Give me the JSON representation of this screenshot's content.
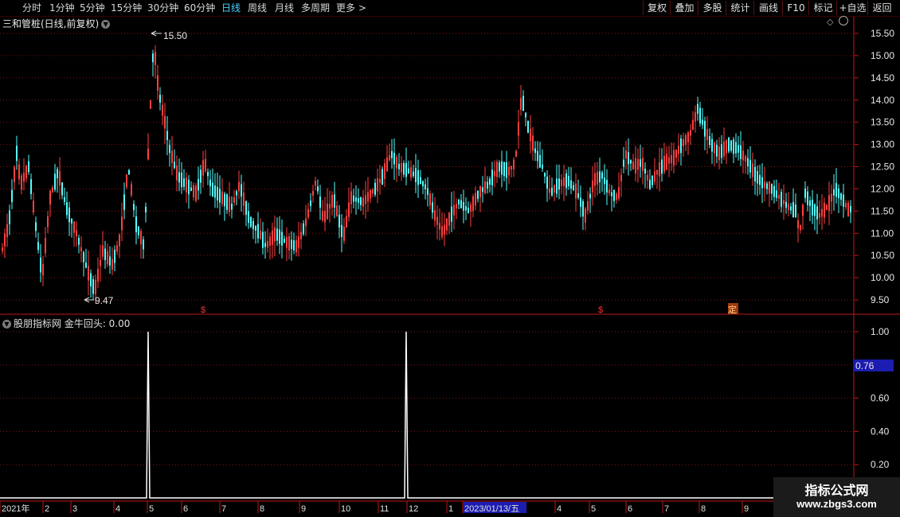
{
  "toolbar": {
    "periods": [
      "分时",
      "1分钟",
      "5分钟",
      "15分钟",
      "30分钟",
      "60分钟",
      "日线",
      "周线",
      "月线",
      "多周期",
      "更多"
    ],
    "active_period": "日线",
    "more_arrow": ">",
    "actions": [
      "复权",
      "叠加",
      "多股",
      "统计",
      "画线",
      "F10",
      "标记",
      "+自选",
      "返回"
    ]
  },
  "chart_header": {
    "title": "三和管桩(日线,前复权)"
  },
  "indicator_header": {
    "title": "股朋指标网 金牛回头: 0.00"
  },
  "price_axis": [
    "15.50",
    "15.00",
    "14.50",
    "14.00",
    "13.50",
    "13.00",
    "12.50",
    "12.00",
    "11.50",
    "11.00",
    "10.50",
    "10.00",
    "9.50"
  ],
  "indicator_axis": [
    "1.00",
    "0.80",
    "0.60",
    "0.40",
    "0.20"
  ],
  "indicator_cursor_value": "0.76",
  "annotations": {
    "high": "15.50",
    "low": "9.47"
  },
  "markers": [
    "$",
    "$",
    "定"
  ],
  "date_axis": [
    "2021年",
    "2",
    "3",
    "4",
    "5",
    "6",
    "7",
    "8",
    "9",
    "10",
    "11",
    "12",
    "1",
    "2023/01/13/五",
    "4",
    "5",
    "6",
    "7",
    "8",
    "9"
  ],
  "watermark": {
    "line1": "指标公式网",
    "line2": "www.zbgs3.com"
  },
  "colors": {
    "up": "#ff4040",
    "down": "#54ffff",
    "grid": "#8a1010",
    "axis_line": "#c01818",
    "cursor_box": "#1c1cb0"
  },
  "chart_data": [
    {
      "type": "candlestick",
      "title": "三和管桩(日线,前复权)",
      "ylim": [
        9.3,
        15.75
      ],
      "y_ticks": [
        15.5,
        15.0,
        14.5,
        14.0,
        13.5,
        13.0,
        12.5,
        12.0,
        11.5,
        11.0,
        10.5,
        10.0,
        9.5
      ],
      "annotated_high": 15.5,
      "annotated_low": 9.47,
      "close_path": [
        [
          0,
          10.5
        ],
        [
          10,
          11.2
        ],
        [
          20,
          12.8
        ],
        [
          25,
          12.1
        ],
        [
          35,
          12.5
        ],
        [
          45,
          11.0
        ],
        [
          52,
          10.0
        ],
        [
          62,
          11.8
        ],
        [
          72,
          12.4
        ],
        [
          82,
          11.6
        ],
        [
          95,
          11.0
        ],
        [
          110,
          10.1
        ],
        [
          118,
          9.7
        ],
        [
          128,
          10.6
        ],
        [
          140,
          10.3
        ],
        [
          150,
          10.9
        ],
        [
          160,
          12.5
        ],
        [
          170,
          11.2
        ],
        [
          180,
          10.7
        ],
        [
          186,
          13.2
        ],
        [
          192,
          15.3
        ],
        [
          198,
          14.2
        ],
        [
          205,
          13.6
        ],
        [
          212,
          12.9
        ],
        [
          222,
          12.3
        ],
        [
          232,
          12.1
        ],
        [
          245,
          11.9
        ],
        [
          256,
          12.6
        ],
        [
          265,
          12.0
        ],
        [
          278,
          11.8
        ],
        [
          290,
          11.6
        ],
        [
          300,
          12.1
        ],
        [
          312,
          11.3
        ],
        [
          325,
          11.0
        ],
        [
          333,
          10.7
        ],
        [
          345,
          11.0
        ],
        [
          358,
          10.8
        ],
        [
          372,
          10.7
        ],
        [
          384,
          11.3
        ],
        [
          396,
          12.2
        ],
        [
          405,
          11.3
        ],
        [
          418,
          11.8
        ],
        [
          430,
          10.9
        ],
        [
          440,
          11.8
        ],
        [
          455,
          11.7
        ],
        [
          470,
          12.0
        ],
        [
          480,
          12.3
        ],
        [
          490,
          12.8
        ],
        [
          500,
          12.5
        ],
        [
          512,
          12.4
        ],
        [
          522,
          12.3
        ],
        [
          535,
          12.0
        ],
        [
          545,
          11.4
        ],
        [
          555,
          11.0
        ],
        [
          565,
          11.4
        ],
        [
          575,
          11.7
        ],
        [
          588,
          11.5
        ],
        [
          600,
          11.9
        ],
        [
          612,
          12.1
        ],
        [
          625,
          12.5
        ],
        [
          638,
          12.4
        ],
        [
          646,
          12.6
        ],
        [
          654,
          14.1
        ],
        [
          662,
          13.4
        ],
        [
          670,
          12.9
        ],
        [
          680,
          12.5
        ],
        [
          690,
          11.9
        ],
        [
          700,
          12.1
        ],
        [
          712,
          12.2
        ],
        [
          724,
          11.9
        ],
        [
          734,
          11.4
        ],
        [
          745,
          12.2
        ],
        [
          755,
          12.3
        ],
        [
          765,
          11.9
        ],
        [
          775,
          11.8
        ],
        [
          784,
          12.8
        ],
        [
          795,
          12.5
        ],
        [
          805,
          12.6
        ],
        [
          815,
          12.1
        ],
        [
          825,
          12.4
        ],
        [
          835,
          12.6
        ],
        [
          845,
          12.7
        ],
        [
          855,
          13.0
        ],
        [
          865,
          13.2
        ],
        [
          875,
          13.8
        ],
        [
          883,
          13.4
        ],
        [
          892,
          13.0
        ],
        [
          902,
          12.8
        ],
        [
          914,
          13.0
        ],
        [
          926,
          12.9
        ],
        [
          938,
          12.6
        ],
        [
          948,
          12.3
        ],
        [
          958,
          12.1
        ],
        [
          968,
          12.0
        ],
        [
          978,
          11.8
        ],
        [
          988,
          11.6
        ],
        [
          998,
          11.5
        ],
        [
          1003,
          11.0
        ],
        [
          1010,
          11.9
        ],
        [
          1018,
          11.6
        ],
        [
          1028,
          11.4
        ],
        [
          1038,
          11.6
        ],
        [
          1048,
          12.0
        ],
        [
          1056,
          11.8
        ],
        [
          1065,
          11.5
        ],
        [
          1070,
          11.6
        ]
      ]
    },
    {
      "type": "line",
      "title": "金牛回头",
      "ylim": [
        0,
        1.05
      ],
      "y_ticks": [
        1.0,
        0.8,
        0.6,
        0.4,
        0.2
      ],
      "baseline": 0,
      "spikes": [
        {
          "x": 186,
          "value": 1.0
        },
        {
          "x": 510,
          "value": 1.0
        }
      ]
    }
  ]
}
